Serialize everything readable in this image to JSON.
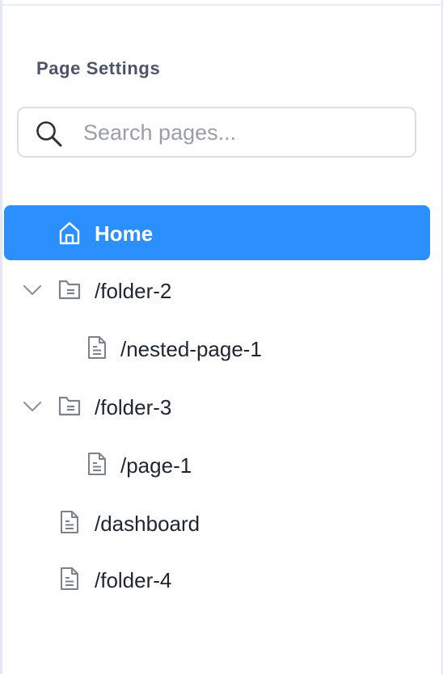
{
  "panel": {
    "title": "Page Settings"
  },
  "search": {
    "placeholder": "Search pages...",
    "value": "",
    "icon": "search-icon"
  },
  "tree": {
    "items": [
      {
        "label": "Home",
        "icon": "home-icon",
        "selected": true
      },
      {
        "label": "/folder-2",
        "icon": "folder-icon",
        "expanded": true
      },
      {
        "label": "/nested-page-1",
        "icon": "page-icon"
      },
      {
        "label": "/folder-3",
        "icon": "folder-icon",
        "expanded": true
      },
      {
        "label": "/page-1",
        "icon": "page-icon"
      },
      {
        "label": "/dashboard",
        "icon": "page-icon"
      },
      {
        "label": "/folder-4",
        "icon": "page-icon"
      }
    ]
  },
  "colors": {
    "selected_bg": "#2b8ffd",
    "text": "#1e2632",
    "title": "#4a5668",
    "icon": "#7b828c"
  }
}
